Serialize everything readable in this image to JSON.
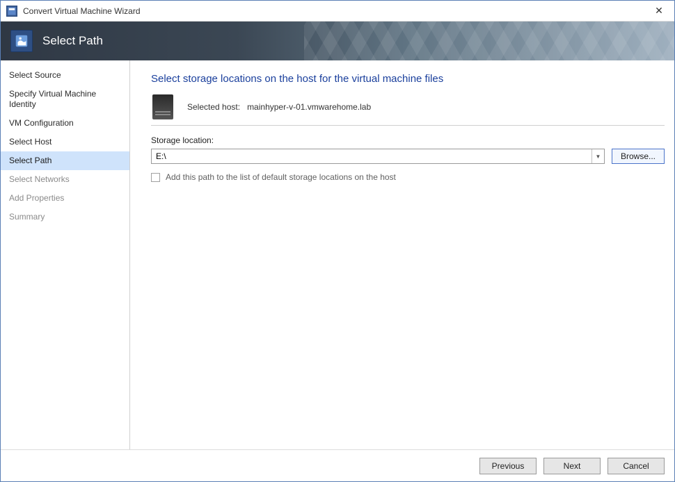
{
  "window": {
    "title": "Convert Virtual Machine Wizard",
    "close_glyph": "✕"
  },
  "banner": {
    "step_title": "Select Path"
  },
  "sidebar": {
    "steps": [
      {
        "label": "Select Source"
      },
      {
        "label": "Specify Virtual Machine Identity"
      },
      {
        "label": "VM Configuration"
      },
      {
        "label": "Select Host"
      },
      {
        "label": "Select Path"
      },
      {
        "label": "Select Networks"
      },
      {
        "label": "Add Properties"
      },
      {
        "label": "Summary"
      }
    ]
  },
  "main": {
    "heading": "Select storage locations on the host for the virtual machine files",
    "selected_host_label": "Selected host:",
    "selected_host_value": "mainhyper-v-01.vmwarehome.lab",
    "storage_location_label": "Storage location:",
    "storage_location_value": "E:\\",
    "browse_label": "Browse...",
    "checkbox_label": "Add this path to the list of default storage locations on the host"
  },
  "footer": {
    "previous": "Previous",
    "next": "Next",
    "cancel": "Cancel"
  }
}
